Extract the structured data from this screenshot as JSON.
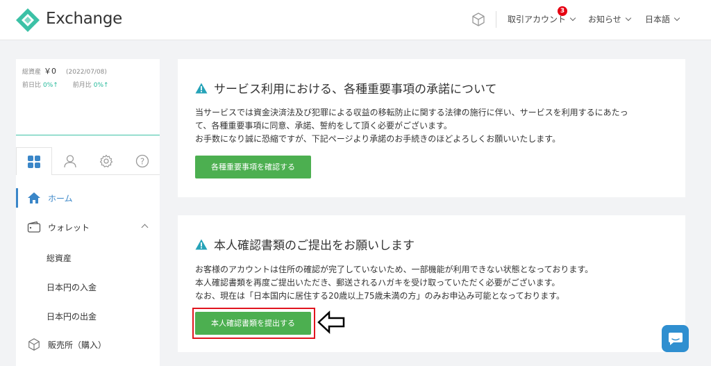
{
  "header": {
    "brand": "Exchange",
    "account_menu": "取引アカウント",
    "account_badge": "3",
    "news_menu": "お知らせ",
    "language": "日本語",
    "colors": {
      "logo": "#3cc1a6",
      "badge": "#e60012"
    }
  },
  "sidebar": {
    "assets": {
      "total_label": "総資産",
      "total_value": "￥0",
      "date": "(2022/07/08)",
      "prev_day_label": "前日比",
      "prev_day_value": "0%↑",
      "prev_month_label": "前月比",
      "prev_month_value": "0%↑"
    },
    "tabs": [
      "home-grid-icon",
      "user-icon",
      "gear-icon",
      "help-icon"
    ],
    "nav": {
      "home": "ホーム",
      "wallet": "ウォレット",
      "wallet_sub": [
        "総資産",
        "日本円の入金",
        "日本円の出金"
      ],
      "shop": "販売所（購入）"
    }
  },
  "cards": {
    "terms": {
      "title": "サービス利用における、各種重要事項の承諾について",
      "lines": [
        "当サービスでは資金決済法及び犯罪による収益の移転防止に関する法律の施行に伴い、サービスを利用するにあたっ",
        "て、各種重要事項に同意、承諾、誓約をして頂く必要がございます。",
        "お手数になり誠に恐縮ですが、下記ページより承諾のお手続きのほどよろしくお願いいたします。"
      ],
      "button": "各種重要事項を確認する"
    },
    "identity": {
      "title": "本人確認書類のご提出をお願いします",
      "lines": [
        "お客様のアカウントは住所の確認が完了していないため、一部機能が利用できない状態となっております。",
        "本人確認書類を再度ご提出いただき、郵送されるハガキを受け取っていただく必要がございます。",
        "なお、現在は「日本国内に居住する20歳以上75歳未満の方」のみお申込み可能となっております。"
      ],
      "button": "本人確認書類を提出する"
    }
  },
  "colors": {
    "accent": "#3a86c8",
    "button": "#4caf50",
    "highlight": "#e0141e",
    "chat": "#2f8fd0"
  }
}
